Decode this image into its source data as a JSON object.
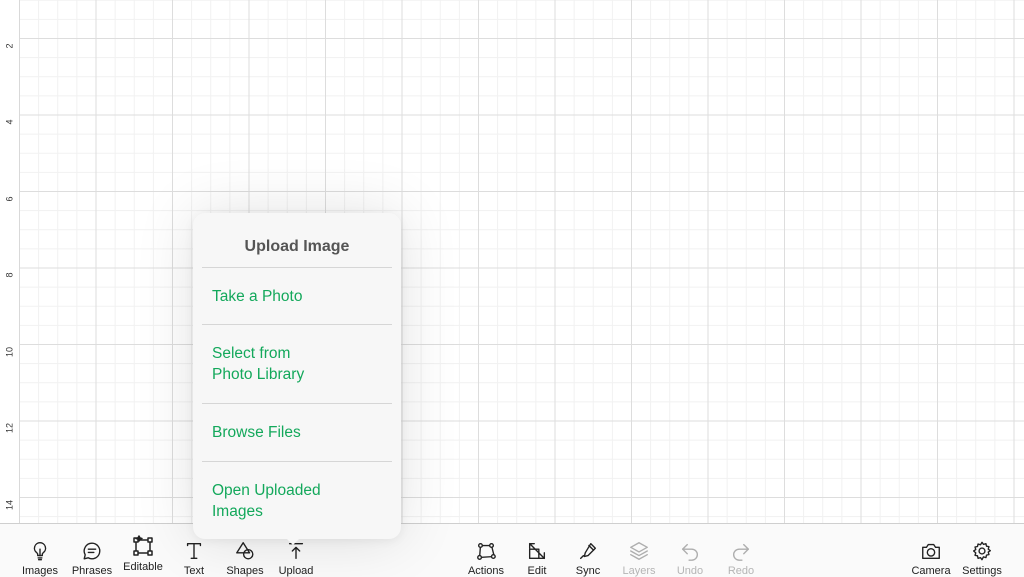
{
  "ruler": {
    "labels": [
      "2",
      "4",
      "6",
      "8",
      "10",
      "12",
      "14"
    ]
  },
  "popover": {
    "title": "Upload Image",
    "items": [
      {
        "line1": "Take a Photo",
        "line2": ""
      },
      {
        "line1": "Select from",
        "line2": "Photo Library"
      },
      {
        "line1": "Browse Files",
        "line2": ""
      },
      {
        "line1": "Open Uploaded",
        "line2": "Images"
      }
    ]
  },
  "toolbar": {
    "left": [
      {
        "label": "Images",
        "icon": "lightbulb-icon"
      },
      {
        "label": "Phrases",
        "icon": "speech-bubble-icon"
      },
      {
        "label": "Editable",
        "icon": "editable-image-icon"
      },
      {
        "label": "Text",
        "icon": "text-icon"
      },
      {
        "label": "Shapes",
        "icon": "shapes-icon"
      },
      {
        "label": "Upload",
        "icon": "upload-icon"
      }
    ],
    "middle": [
      {
        "label": "Actions",
        "icon": "actions-icon"
      },
      {
        "label": "Edit",
        "icon": "edit-icon"
      },
      {
        "label": "Sync",
        "icon": "color-sync-icon"
      },
      {
        "label": "Layers",
        "icon": "layers-icon"
      },
      {
        "label": "Undo",
        "icon": "undo-icon"
      },
      {
        "label": "Redo",
        "icon": "redo-icon"
      }
    ],
    "right": [
      {
        "label": "Camera",
        "icon": "camera-icon"
      },
      {
        "label": "Settings",
        "icon": "gear-icon"
      }
    ]
  },
  "colors": {
    "accent": "#13a85b",
    "grid_major": "#dddddd",
    "grid_minor": "#f1f1f1"
  }
}
